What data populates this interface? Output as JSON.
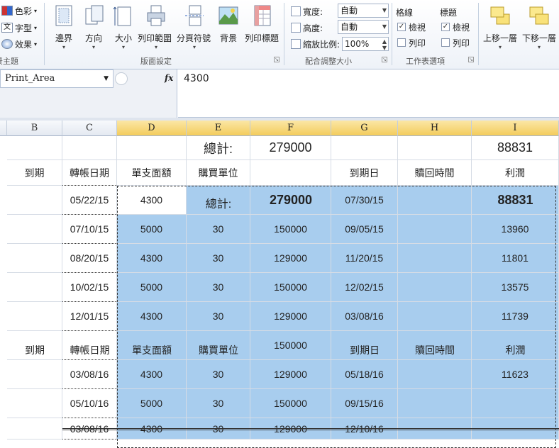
{
  "ribbon": {
    "themes": {
      "colors": "色彩",
      "fonts": "字型",
      "effects": "效果",
      "group_label": "佈景主題"
    },
    "page_setup": {
      "margins": "邊界",
      "orientation": "方向",
      "size": "大小",
      "print_area": "列印範圍",
      "breaks": "分頁符號",
      "background": "背景",
      "print_titles": "列印標題",
      "group_label": "版面設定"
    },
    "scale_to_fit": {
      "width_label": "寬度:",
      "width_value": "自動",
      "height_label": "高度:",
      "height_value": "自動",
      "scale_label": "縮放比例:",
      "scale_value": "100%",
      "group_label": "配合調整大小"
    },
    "sheet_options": {
      "gridlines": "格線",
      "headings": "標題",
      "view": "檢視",
      "print": "列印",
      "group_label": "工作表選項"
    },
    "arrange": {
      "bring_forward": "上移一層",
      "send_backward": "下移一層"
    }
  },
  "formula_bar": {
    "name_box": "Print_Area",
    "fx": "fx",
    "value": "4300"
  },
  "columns": [
    "B",
    "C",
    "D",
    "E",
    "F",
    "G",
    "H",
    "I"
  ],
  "header_rows": {
    "total_label": "總計:",
    "total_f": "279000",
    "total_i": "88831",
    "col_headers": [
      "到期",
      "轉帳日期",
      "單支面額",
      "購買單位",
      "",
      "到期日",
      "贖回時間",
      "利潤"
    ]
  },
  "rows": [
    {
      "c": "05/22/15",
      "d": "4300",
      "e": "",
      "f": "",
      "g": "07/30/15",
      "h": "",
      "i": ""
    },
    {
      "c": "07/10/15",
      "d": "5000",
      "e": "30",
      "f": "150000",
      "g": "09/05/15",
      "h": "",
      "i": "13960"
    },
    {
      "c": "08/20/15",
      "d": "4300",
      "e": "30",
      "f": "129000",
      "g": "11/20/15",
      "h": "",
      "i": "11801"
    },
    {
      "c": "10/02/15",
      "d": "5000",
      "e": "30",
      "f": "150000",
      "g": "12/02/15",
      "h": "",
      "i": "13575"
    },
    {
      "c": "12/01/15",
      "d": "4300",
      "e": "30",
      "f": "129000",
      "g": "03/08/16",
      "h": "",
      "i": "11739"
    },
    {
      "c": "",
      "d": "",
      "e": "",
      "f": "150000",
      "g": "",
      "h": "",
      "i": ""
    },
    {
      "c": "03/08/16",
      "d": "4300",
      "e": "30",
      "f": "129000",
      "g": "05/18/16",
      "h": "",
      "i": "11623"
    },
    {
      "c": "05/10/16",
      "d": "5000",
      "e": "30",
      "f": "150000",
      "g": "09/15/16",
      "h": "",
      "i": ""
    },
    {
      "c": "03/08/16",
      "d": "4300",
      "e": "30",
      "f": "129000",
      "g": "12/10/16",
      "h": "",
      "i": ""
    }
  ],
  "ghost": {
    "total_label": "總計:",
    "total_f": "279000",
    "total_i": "88831",
    "col_headers": [
      "到期",
      "轉帳日期",
      "單支面額",
      "購買單位",
      "到期日",
      "贖回時間",
      "利潤"
    ]
  }
}
